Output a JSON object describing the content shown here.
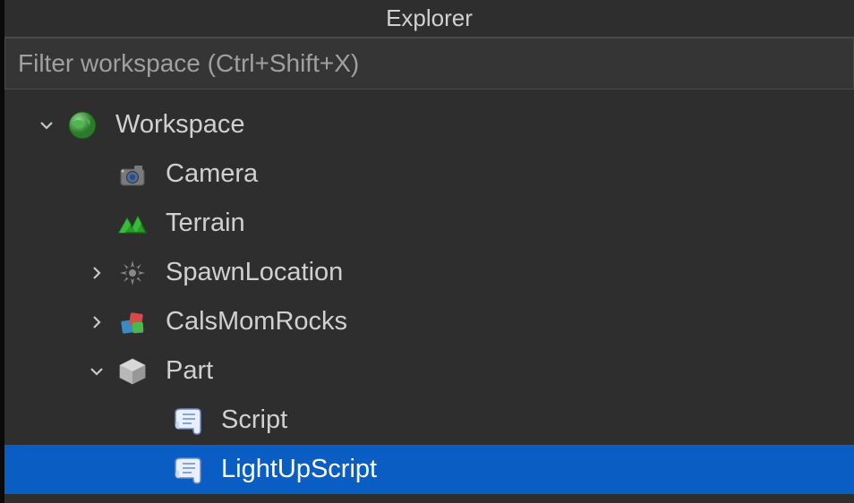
{
  "panel": {
    "title": "Explorer"
  },
  "filter": {
    "placeholder": "Filter workspace (Ctrl+Shift+X)"
  },
  "tree": {
    "workspace": {
      "label": "Workspace"
    },
    "camera": {
      "label": "Camera"
    },
    "terrain": {
      "label": "Terrain"
    },
    "spawnlocation": {
      "label": "SpawnLocation"
    },
    "calsmomrocks": {
      "label": "CalsMomRocks"
    },
    "part": {
      "label": "Part"
    },
    "script": {
      "label": "Script"
    },
    "lightupscript": {
      "label": "LightUpScript"
    }
  }
}
